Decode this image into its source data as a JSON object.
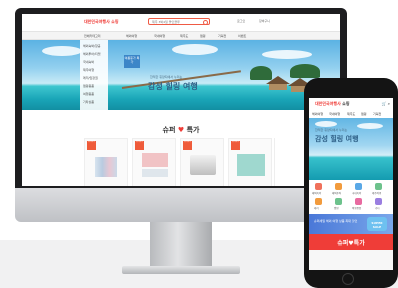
{
  "desktop": {
    "logo": "대한민국여행사 쇼핑",
    "search_placeholder": "제주 3박4일 올인클루",
    "header_links": [
      "로그인",
      "장바구니"
    ],
    "nav": [
      "전체카테고리",
      "해외여행",
      "국내여행",
      "제주도",
      "캠핑",
      "기획전",
      "이벤트"
    ],
    "sidebar": [
      "해외숙박/항공",
      "해외투어/티켓",
      "국내숙박",
      "제주여행",
      "레저/입장권",
      "캠핑용품",
      "여행용품",
      "기타상품"
    ],
    "banner": {
      "promo_badge": "여름휴가 특가",
      "subtitle": "한적한 휴양지에서 누리는",
      "title": "감성 힐링 여행"
    },
    "deals_title_prefix": "슈퍼",
    "deals_title_accent": "♥",
    "deals_title_suffix": "특가",
    "product_tag": "슈퍼특가"
  },
  "mobile": {
    "logo": "대한민국여행사",
    "logo_suffix": "쇼핑",
    "header_icons": "🛒 ⌕",
    "tabs": [
      "해외여행",
      "국내여행",
      "제주도",
      "캠핑",
      "기획전"
    ],
    "banner_subtitle": "한적한 휴양지에서 누리는",
    "banner_title": "감성 힐링 여행",
    "icon_labels": [
      "해외숙박",
      "해외투어",
      "국내숙박",
      "제주여행",
      "레저",
      "캠핑",
      "여행용품",
      "기타"
    ],
    "promo_text": "슈퍼세일 해외 여행 상품 최대 할인",
    "promo_badge": "SUPER SALE",
    "deals_label": "슈퍼♥특가"
  },
  "colors": {
    "brand_red": "#ef3d38",
    "sky": "#5bb2e3",
    "sea": "#1aa6b8",
    "promo_blue": "#4a78d8"
  }
}
